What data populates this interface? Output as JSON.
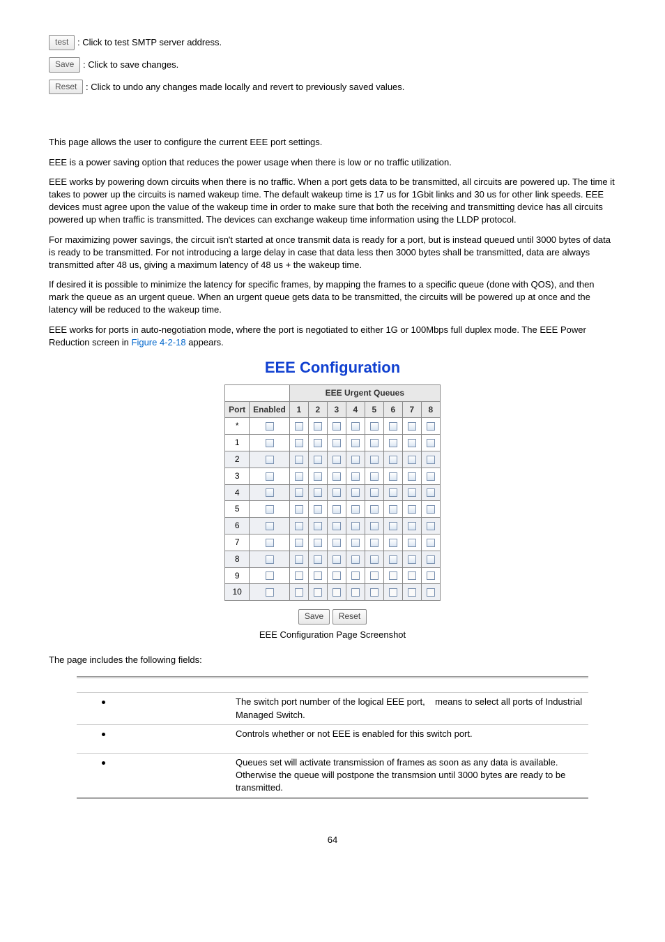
{
  "buttons_top": {
    "test": {
      "label": "test",
      "desc": ": Click to test SMTP server address."
    },
    "save": {
      "label": "Save",
      "desc": ": Click to save changes."
    },
    "reset": {
      "label": "Reset",
      "desc": ": Click to undo any changes made locally and revert to previously saved values."
    }
  },
  "paragraphs": {
    "p1": "This page allows the user to configure the current EEE port settings.",
    "p2": "EEE is a power saving option that reduces the power usage when there is low or no traffic utilization.",
    "p3": "EEE works by powering down circuits when there is no traffic. When a port gets data to be transmitted, all circuits are powered up. The time it takes to power up the circuits is named wakeup time. The default wakeup time is 17 us for 1Gbit links and 30 us for other link speeds. EEE devices must agree upon the value of the wakeup time in order to make sure that both the receiving and transmitting device has all circuits powered up when traffic is transmitted. The devices can exchange wakeup time information using the LLDP protocol.",
    "p4": "For maximizing power savings, the circuit isn't started at once transmit data is ready for a port, but is instead queued until 3000 bytes of data is ready to be transmitted. For not introducing a large delay in case that data less then 3000 bytes shall be transmitted, data are always transmitted after 48 us, giving a maximum latency of 48 us + the wakeup time.",
    "p5": "If desired it is possible to minimize the latency for specific frames, by mapping the frames to a specific queue (done with QOS), and then mark the queue as an urgent queue. When an urgent queue gets data to be transmitted, the circuits will be powered up at once and the latency will be reduced to the wakeup time.",
    "p6_a": "EEE works for ports in auto-negotiation mode, where the port is negotiated to either 1G or 100Mbps full duplex mode. The EEE Power Reduction screen in ",
    "p6_b": "Figure 4-2-18",
    "p6_c": " appears."
  },
  "fig": {
    "title": "EEE Configuration",
    "headers": {
      "port": "Port",
      "enabled": "Enabled",
      "queues": "EEE Urgent Queues",
      "cols": [
        "1",
        "2",
        "3",
        "4",
        "5",
        "6",
        "7",
        "8"
      ]
    },
    "rows": [
      "*",
      "1",
      "2",
      "3",
      "4",
      "5",
      "6",
      "7",
      "8",
      "9",
      "10"
    ],
    "btn_save": "Save",
    "btn_reset": "Reset",
    "caption": "EEE Configuration Page Screenshot"
  },
  "fields_intro": "The page includes the following fields:",
  "fields": {
    "r1": "The switch port number of the logical EEE port,    means to select all ports of Industrial Managed Switch.",
    "r2": "Controls whether or not EEE is enabled for this switch port.",
    "r3": "Queues set will activate transmission of frames as soon as any data is available. Otherwise the queue will postpone the transmsion until 3000 bytes are ready to be transmitted."
  },
  "page_num": "64"
}
